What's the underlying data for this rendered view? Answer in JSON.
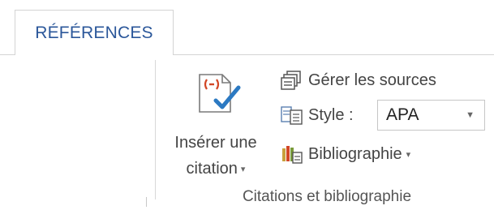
{
  "ribbon": {
    "active_tab": "RÉFÉRENCES",
    "accent_color": "#2b579a",
    "group": {
      "label": "Citations et bibliographie",
      "insert_citation": {
        "line1": "Insérer une",
        "line2": "citation",
        "icon": "insert-citation-icon"
      },
      "manage_sources": {
        "label": "Gérer les sources",
        "icon": "manage-sources-icon"
      },
      "style": {
        "label": "Style :",
        "value": "APA",
        "icon": "style-icon"
      },
      "bibliography": {
        "label": "Bibliographie",
        "icon": "bibliography-icon"
      }
    }
  }
}
